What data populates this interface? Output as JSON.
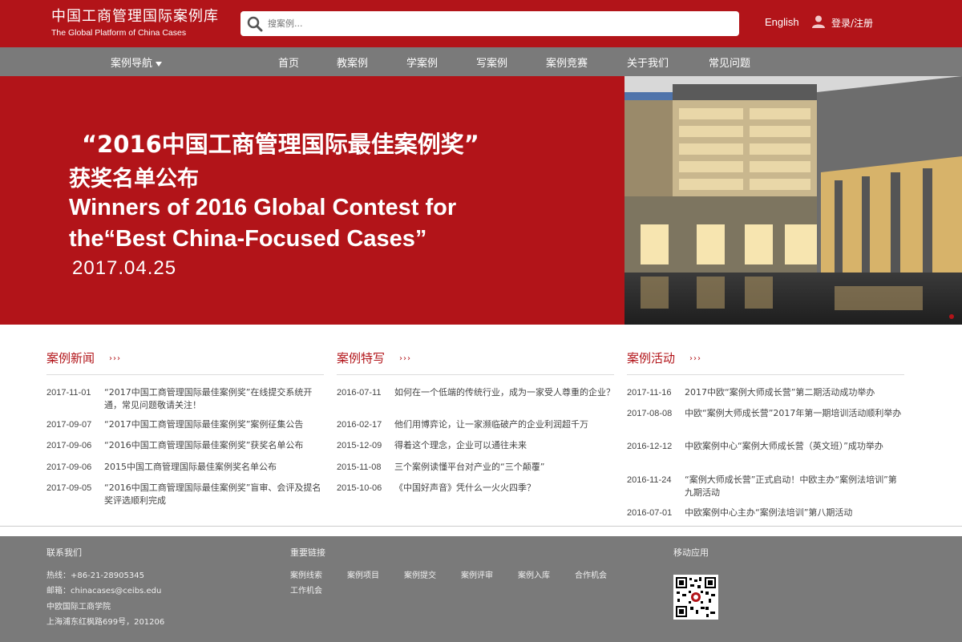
{
  "header": {
    "logo_cn": "中国工商管理国际案例库",
    "logo_en": "The Global Platform of China Cases",
    "search_placeholder": "搜案例...",
    "lang_link": "English",
    "login_link": "登录/注册"
  },
  "nav": {
    "dropdown_label": "案例导航",
    "items": [
      "首页",
      "教案例",
      "学案例",
      "写案例",
      "案例竞赛",
      "关于我们",
      "常见问题"
    ]
  },
  "banner": {
    "line1": "“2016中国工商管理国际最佳案例奖”",
    "line2": "获奖名单公布",
    "line3": "Winners of 2016 Global Contest for",
    "line4": "the“Best China-Focused Cases”",
    "date": "2017.04.25"
  },
  "columns": [
    {
      "title": "案例新闻",
      "more": "›››",
      "items": [
        {
          "date": "2017-11-01",
          "title": "“2017中国工商管理国际最佳案例奖”在线提交系统开通，常见问题敬请关注！"
        },
        {
          "date": "2017-09-07",
          "title": "“2017中国工商管理国际最佳案例奖”案例征集公告"
        },
        {
          "date": "2017-09-06",
          "title": "“2016中国工商管理国际最佳案例奖”获奖名单公布"
        },
        {
          "date": "2017-09-06",
          "title": "2015中国工商管理国际最佳案例奖名单公布"
        },
        {
          "date": "2017-09-05",
          "title": "“2016中国工商管理国际最佳案例奖”盲审、会评及提名奖评选顺利完成"
        }
      ]
    },
    {
      "title": "案例特写",
      "more": "›››",
      "items": [
        {
          "date": "2016-07-11",
          "title": "如何在一个低端的传统行业，成为一家受人尊重的企业？"
        },
        {
          "date": "2016-02-17",
          "title": "他们用博弈论，让一家濒临破产的企业利润超千万"
        },
        {
          "date": "2015-12-09",
          "title": "得着这个理念，企业可以通往未来"
        },
        {
          "date": "2015-11-08",
          "title": "三个案例读懂平台对产业的“三个颠覆”"
        },
        {
          "date": "2015-10-06",
          "title": "《中国好声音》凭什么一火火四季？"
        }
      ]
    },
    {
      "title": "案例活动",
      "more": "›››",
      "items": [
        {
          "date": "2017-11-16",
          "title": "2017中欧“案例大师成长营”第二期活动成功举办"
        },
        {
          "date": "2017-08-08",
          "title": "中欧“案例大师成长营”2017年第一期培训活动顺利举办"
        },
        {
          "date": "2016-12-12",
          "title": "中欧案例中心“案例大师成长营（英文班）”成功举办"
        },
        {
          "date": "2016-11-24",
          "title": "“案例大师成长营”正式启动！中欧主办“案例法培训”第九期活动"
        },
        {
          "date": "2016-07-01",
          "title": "中欧案例中心主办“案例法培训”第八期活动"
        }
      ]
    }
  ],
  "footer": {
    "contact_title": "联系我们",
    "hotline": "热线：+86-21-28905345",
    "email": "邮箱：chinacases@ceibs.edu",
    "org": "中欧国际工商学院",
    "address": "上海浦东红枫路699号，201206",
    "links_title": "重要链接",
    "links": [
      "案例线索",
      "案例项目",
      "案例提交",
      "案例评审",
      "案例入库",
      "合作机会",
      "工作机会"
    ],
    "mobile_title": "移动应用"
  },
  "colors": {
    "brand_red": "#b21419",
    "nav_gray": "#7a7a7a",
    "footer_gray": "#7a7a7a"
  }
}
